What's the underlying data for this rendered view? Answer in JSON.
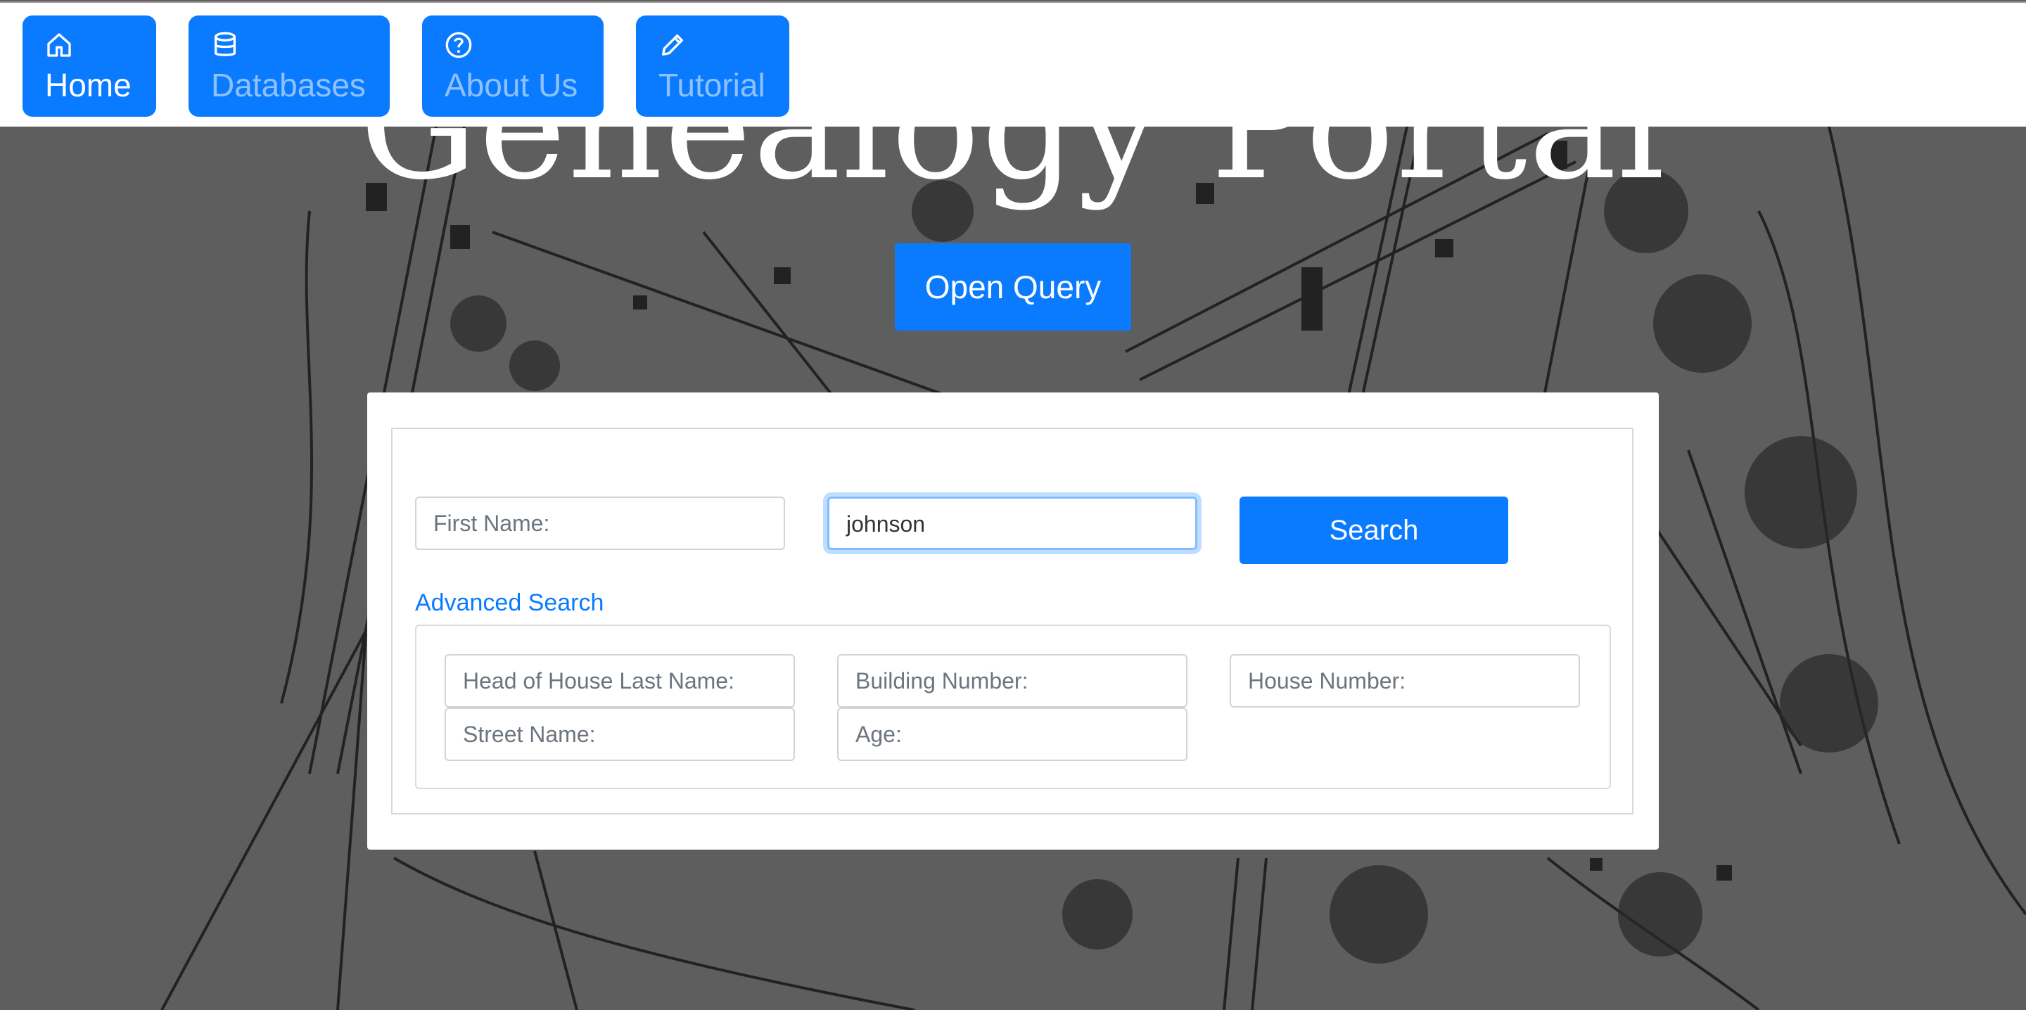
{
  "title": "Genealogy Portal",
  "nav": {
    "items": [
      {
        "label": "Home",
        "icon": "home-icon",
        "active": true
      },
      {
        "label": "Databases",
        "icon": "database-icon",
        "active": false
      },
      {
        "label": "About Us",
        "icon": "question-circle-icon",
        "active": false
      },
      {
        "label": "Tutorial",
        "icon": "pencil-icon",
        "active": false
      }
    ]
  },
  "open_query_label": "Open Query",
  "search": {
    "first_name_placeholder": "First Name:",
    "last_name_value": "johnson",
    "button_label": "Search"
  },
  "advanced": {
    "link_label": "Advanced Search",
    "head_of_house_placeholder": "Head of House Last Name:",
    "building_number_placeholder": "Building Number:",
    "house_number_placeholder": "House Number:",
    "street_name_placeholder": "Street Name:",
    "age_placeholder": "Age:"
  },
  "colors": {
    "primary": "#0a7bff",
    "nav_inactive_text": "#8fc1ff",
    "focus_ring": "#80bdff"
  }
}
